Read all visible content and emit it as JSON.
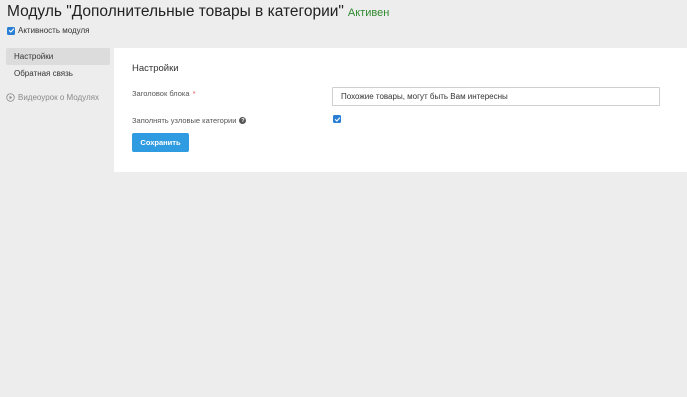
{
  "header": {
    "title": "Модуль \"Дополнительные товары в категории\"",
    "status": "Активен",
    "status_color": "#2f8a2f"
  },
  "module_active": {
    "label": "Активность модуля",
    "checked": true
  },
  "sidebar": {
    "items": [
      {
        "label": "Настройки",
        "active": true
      },
      {
        "label": "Обратная связь",
        "active": false
      }
    ],
    "video_link": {
      "label": "Видеоурок о Модулях",
      "icon": "play-circle-icon"
    }
  },
  "settings": {
    "title": "Настройки",
    "block_title": {
      "label": "Заголовок блока",
      "required_mark": "*",
      "value": "Похожие товары, могут быть Вам интересны"
    },
    "fill_parent": {
      "label": "Заполнять узловые категории",
      "help_icon": "help-icon",
      "checked": true
    },
    "save_label": "Сохранить"
  },
  "colors": {
    "accent": "#2f9be0",
    "checkbox": "#2a7fd4",
    "background": "#ededed"
  }
}
